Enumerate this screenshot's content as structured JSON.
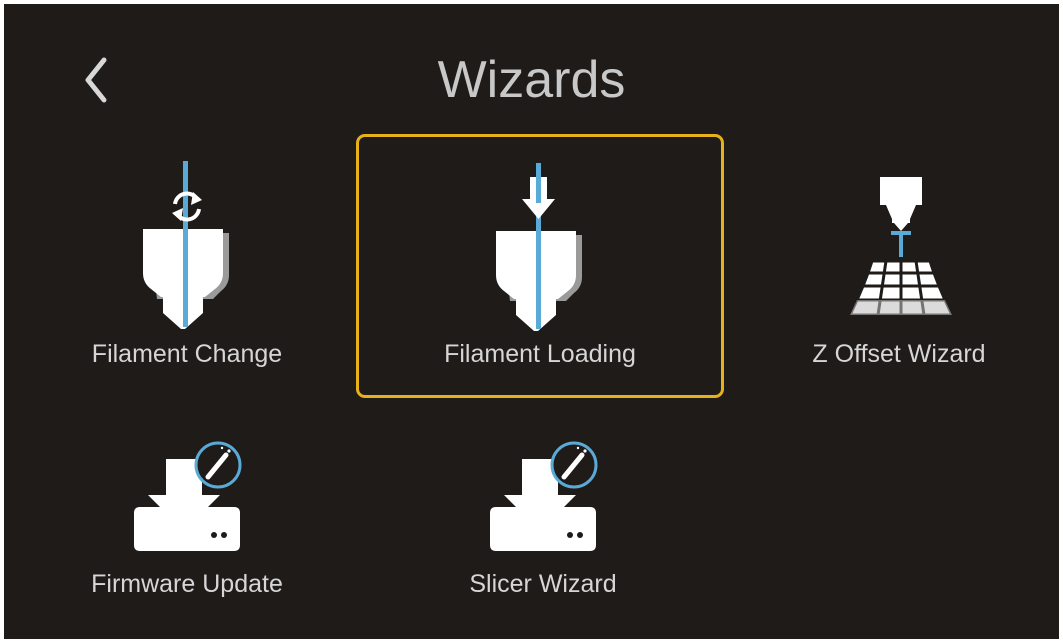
{
  "header": {
    "title": "Wizards",
    "back_icon": "chevron-left-icon"
  },
  "colors": {
    "background": "#1e1b19",
    "selection_border": "#e8b11a",
    "filament_blue": "#5aaad8",
    "text": "#d6d6d6"
  },
  "wizards": [
    {
      "label": "Filament Change",
      "icon": "filament-change-icon",
      "selected": false
    },
    {
      "label": "Filament Loading",
      "icon": "filament-loading-icon",
      "selected": true
    },
    {
      "label": "Z Offset Wizard",
      "icon": "z-offset-icon",
      "selected": false
    },
    {
      "label": "Firmware Update",
      "icon": "firmware-update-icon",
      "selected": false
    },
    {
      "label": "Slicer Wizard",
      "icon": "slicer-wizard-icon",
      "selected": false
    }
  ]
}
